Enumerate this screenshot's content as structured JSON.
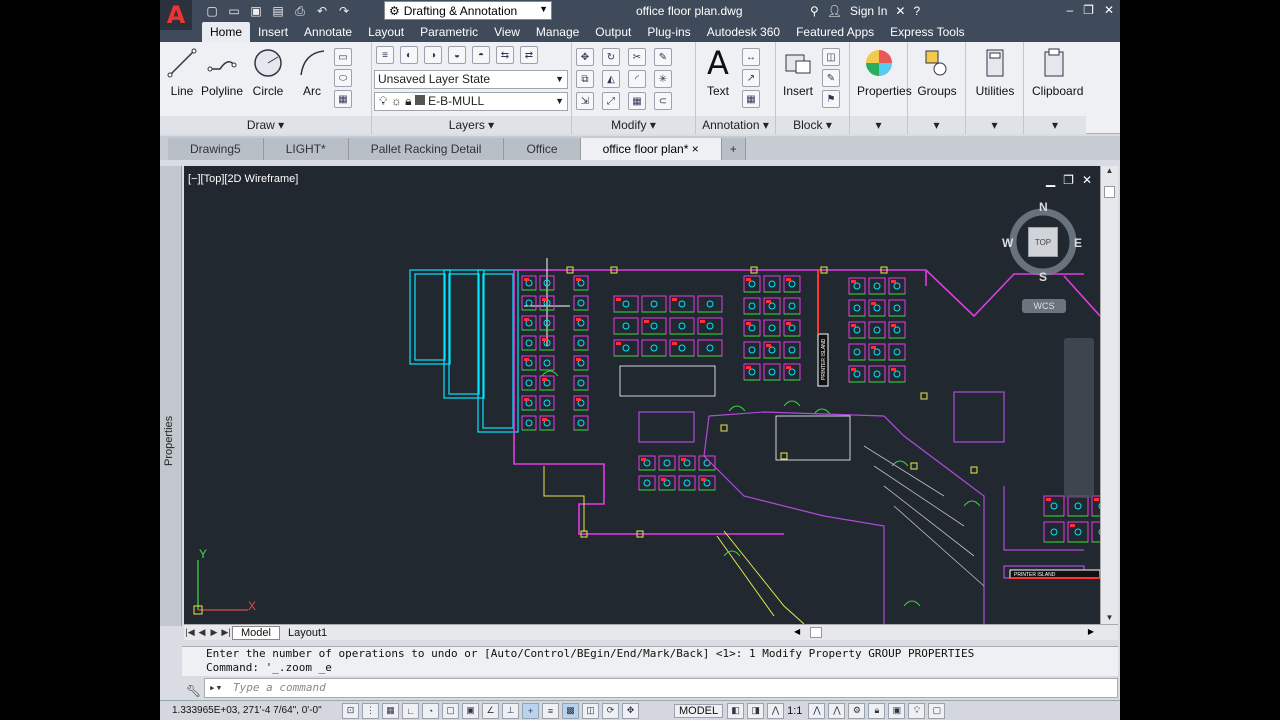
{
  "title_bar": {
    "workspace": "Drafting & Annotation",
    "document_title": "office floor plan.dwg",
    "sign_in": "Sign In",
    "quick_access_icons": [
      "new-icon",
      "open-icon",
      "save-icon",
      "save-as-icon",
      "plot-icon",
      "undo-icon",
      "redo-icon"
    ]
  },
  "ribbon_tabs": [
    "Home",
    "Insert",
    "Annotate",
    "Layout",
    "Parametric",
    "View",
    "Manage",
    "Output",
    "Plug-ins",
    "Autodesk 360",
    "Featured Apps",
    "Express Tools"
  ],
  "ribbon": {
    "draw": {
      "title": "Draw",
      "tools": [
        "Line",
        "Polyline",
        "Circle",
        "Arc"
      ]
    },
    "layers": {
      "title": "Layers",
      "layer_state": "Unsaved Layer State",
      "current_layer": "E-B-MULL"
    },
    "modify": {
      "title": "Modify"
    },
    "annotation": {
      "title": "Annotation",
      "text_label": "Text"
    },
    "block": {
      "title": "Block",
      "insert_label": "Insert"
    },
    "properties_label": "Properties",
    "groups_label": "Groups",
    "utilities_label": "Utilities",
    "clipboard_label": "Clipboard"
  },
  "doc_tabs": [
    "Drawing5",
    "LIGHT*",
    "Pallet Racking Detail",
    "Office",
    "office floor plan*"
  ],
  "properties_palette_label": "Properties",
  "viewport": {
    "label": "[−][Top][2D Wireframe]",
    "viewcube": {
      "n": "N",
      "s": "S",
      "e": "E",
      "w": "W",
      "face": "TOP",
      "wcs": "WCS"
    },
    "printer_island_labels": [
      "PRINTER ISLAND",
      "PRINTER ISLAND"
    ]
  },
  "layout_tabs": [
    "Model",
    "Layout1"
  ],
  "command_history": [
    "Enter the number of operations to undo or [Auto/Control/BEgin/End/Mark/Back] <1>: 1 Modify Property GROUP PROPERTIES",
    "Command: '_.zoom _e"
  ],
  "command_placeholder": "Type a command",
  "status_bar": {
    "coordinates": "1.333965E+03, 271'-4 7/64\", 0'-0\"",
    "model_label": "MODEL",
    "scale": "1:1"
  },
  "colors": {
    "canvas_bg": "#212830",
    "ribbon_bg": "#eef0f3",
    "titlebar_bg": "#3f4a5a"
  }
}
